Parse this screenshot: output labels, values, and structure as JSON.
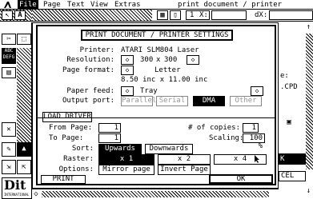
{
  "menubar": {
    "items": [
      "File",
      "Page",
      "Text",
      "View",
      "Extras"
    ],
    "window_title": "print document / printer settings"
  },
  "toolbar": {
    "zoom_label": "1",
    "x_label": "X:",
    "dx_label": "dX:"
  },
  "left_panel": {
    "labels": [
      "ABC",
      "DEFG"
    ],
    "logo_text": "Dit",
    "logo_subtext": "INTERNATIONAL"
  },
  "right_panel": {
    "e_label": "e:",
    "file_ext": ".CPD",
    "k_label": "K",
    "cel_label": "CEL"
  },
  "dialog": {
    "title": "PRINT DOCUMENT / PRINTER SETTINGS",
    "printer_label": "Printer:",
    "printer_value": "ATARI SLM804 Laser",
    "resolution_label": "Resolution:",
    "resolution_x": "300",
    "resolution_sep": "x",
    "resolution_y": "300",
    "page_format_label": "Page format:",
    "page_format_value": "Letter",
    "page_size": "8.50 inc  x  11.00 inc",
    "paper_feed_label": "Paper feed:",
    "paper_feed_value": "Tray",
    "output_port_label": "Output port:",
    "ports": [
      "Parallel",
      "Serial",
      "DMA",
      "Other"
    ],
    "active_port": "DMA",
    "load_driver": "LOAD DRIVER",
    "from_page_label": "From Page:",
    "from_page_value": "1",
    "to_page_label": "To Page:",
    "to_page_value": "1",
    "copies_label": "# of copies:",
    "copies_value": "1",
    "scaling_label": "Scaling:",
    "scaling_value": "100 %",
    "sort_label": "Sort:",
    "sort_options": [
      "Upwards",
      "Downwards"
    ],
    "active_sort": "Upwards",
    "raster_label": "Raster:",
    "raster_options": [
      "x 1",
      "x 2",
      "x 4"
    ],
    "active_raster": "x 1",
    "options_label": "Options:",
    "mirror_page": "Mirror page",
    "invert_page": "Invert Page",
    "print_button": "PRINT",
    "ok_button": "OK",
    "diamond": "◇"
  }
}
